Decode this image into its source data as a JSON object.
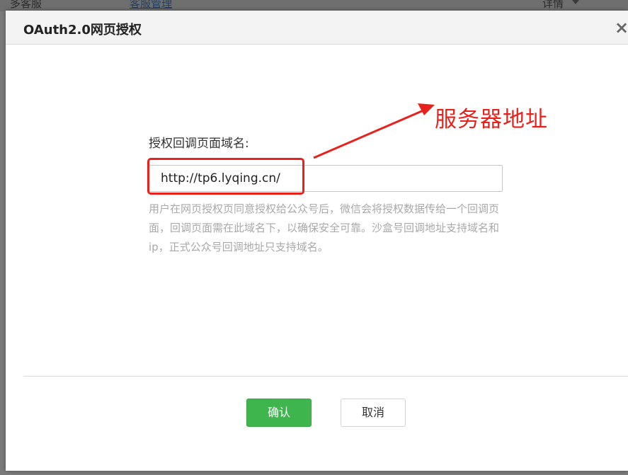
{
  "background": {
    "left_text": "多客服",
    "link_text": "客服管理",
    "right_text": "详情"
  },
  "dialog": {
    "title": "OAuth2.0网页授权",
    "close_glyph": "×",
    "field_label": "授权回调页面域名:",
    "input_value": "http://tp6.lyqing.cn/",
    "help_text": "用户在网页授权页同意授权给公众号后，微信会将授权数据传给一个回调页面，回调页面需在此域名下，以确保安全可靠。沙盒号回调地址支持域名和ip，正式公众号回调地址只支持域名。",
    "confirm_label": "确认",
    "cancel_label": "取消"
  },
  "annotation": {
    "text": "服务器地址",
    "color": "#e8221b"
  },
  "colors": {
    "confirm_button": "#3fb54e",
    "overlay": "#7b7b7b"
  }
}
